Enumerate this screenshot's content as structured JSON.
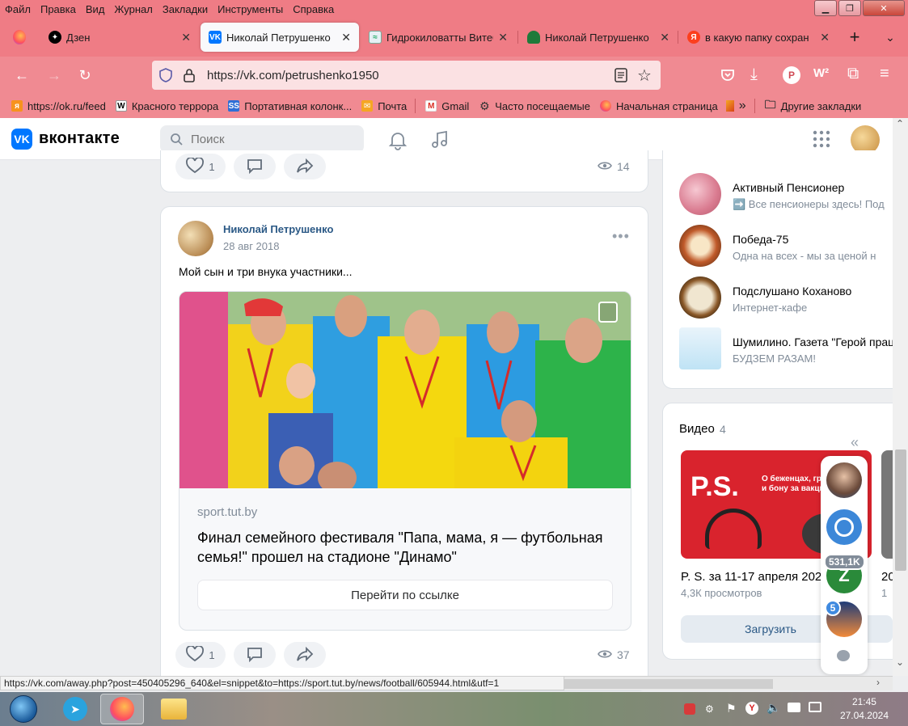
{
  "menu": [
    "Файл",
    "Правка",
    "Вид",
    "Журнал",
    "Закладки",
    "Инструменты",
    "Справка"
  ],
  "tabs": [
    {
      "label": "Дзен",
      "icon": "dzen-icon"
    },
    {
      "label": "Николай Петрушенко",
      "icon": "vk-icon",
      "active": true
    },
    {
      "label": "Гидрокиловатты Витеб",
      "icon": "hydro-icon"
    },
    {
      "label": "Николай Петрушенко",
      "icon": "ok-icon"
    },
    {
      "label": "в какую папку сохран",
      "icon": "yandex-icon"
    }
  ],
  "address": {
    "url": "https://vk.com/petrushenko1950"
  },
  "bookmarks": [
    {
      "label": "https://ok.ru/feed",
      "icon": "ok-icon"
    },
    {
      "label": "Красного террора",
      "icon": "wikipedia-icon"
    },
    {
      "label": "Портативная колонк...",
      "icon": "ss-icon"
    },
    {
      "label": "Почта",
      "icon": "mail-icon"
    },
    {
      "label": "Gmail",
      "icon": "gmail-icon"
    },
    {
      "label": "Часто посещаемые",
      "icon": "gear-icon"
    },
    {
      "label": "Начальная страница",
      "icon": "firefox-icon"
    },
    {
      "label": "Другие закладки",
      "icon": "folder-icon"
    }
  ],
  "vk": {
    "brand": "вконтакте",
    "search_placeholder": "Поиск"
  },
  "top_post": {
    "likes": "1",
    "views": "14"
  },
  "post": {
    "author": "Николай Петрушенко",
    "date": "28 авг 2018",
    "text": "Мой сын и три внука участники...",
    "snippet": {
      "domain": "sport.tut.by",
      "title": "Финал семейного фестиваля \"Папа, мама, я — футбольная семья!\" прошел на стадионе \"Динамо\"",
      "button": "Перейти по ссылке"
    },
    "likes": "1",
    "views": "37"
  },
  "groups": [
    {
      "name": "Активный Пенсионер",
      "sub": "➡️ Все пенсионеры здесь! Под"
    },
    {
      "name": "Победа-75",
      "sub": "Одна на всех - мы за ценой н"
    },
    {
      "name": "Подслушано Коханово",
      "sub": "Интернет-кафе"
    },
    {
      "name": "Шумилино. Газета \"Герой прац",
      "sub": "БУДЗЕМ РАЗАМ!"
    }
  ],
  "videos": {
    "title": "Видео",
    "count": "4",
    "items": [
      {
        "title": "P. S. за 11-17 апреля 202",
        "views": "4,3К просмотров",
        "thumb_text": "P.S.",
        "thumb_caption": "О беженцах, гра на замке и бону за вакцинацию"
      },
      {
        "title": "20",
        "views": "1"
      }
    ],
    "load_button": "Загрузить"
  },
  "chat_bubbles": {
    "badge1": "531,1K",
    "badge2": "5"
  },
  "status_url": "https://vk.com/away.php?post=450405296_640&el=snippet&to=https://sport.tut.by/news/football/605944.html&utf=1",
  "clock": {
    "time": "21:45",
    "date": "27.04.2024"
  }
}
